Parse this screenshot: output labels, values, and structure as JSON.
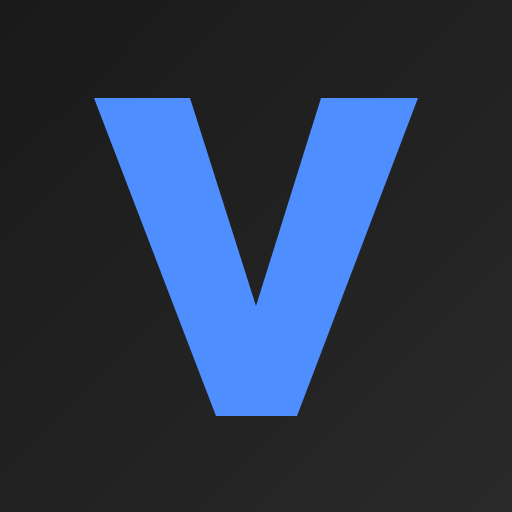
{
  "icon": {
    "logo_letter": "V",
    "accent_color": "#4f8eff",
    "background_color": "#1e1e1e"
  }
}
